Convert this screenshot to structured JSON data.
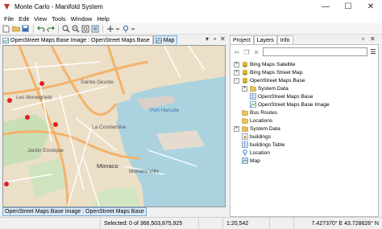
{
  "window": {
    "title": "Monte Carlo - Manifold System"
  },
  "menu": [
    "File",
    "Edit",
    "View",
    "Tools",
    "Window",
    "Help"
  ],
  "map_tabs": [
    {
      "label": "OpenStreet Maps Base Image : OpenStreet Maps Base"
    },
    {
      "label": "Map"
    }
  ],
  "bottom_tab": "OpenStreet Maps Base Image : OpenStreet Maps Base",
  "map": {
    "labels": [
      "Sainte Devote",
      "Les Moneghetti",
      "Port Hercule",
      "La Condamine",
      "Jardin Exotique",
      "Monaco",
      "Monaco Ville"
    ]
  },
  "right_tabs": [
    "Project",
    "Layers",
    "Info"
  ],
  "project_search": {
    "value": ""
  },
  "tree": [
    {
      "label": "Bing Maps Satellite",
      "icon": "database-icon",
      "expanded": false
    },
    {
      "label": "Bing Maps Street Map",
      "icon": "database-icon",
      "expanded": false
    },
    {
      "label": "OpenStreet Maps Base",
      "icon": "database-icon",
      "expanded": true
    },
    {
      "label": "System Data",
      "icon": "folder-icon",
      "expanded": false
    },
    {
      "label": "OpenStreet Maps Base",
      "icon": "table-icon"
    },
    {
      "label": "OpenStreet Maps Base Image",
      "icon": "image-icon"
    },
    {
      "label": "Bus Routes",
      "icon": "folder-icon"
    },
    {
      "label": "Locations",
      "icon": "folder-icon"
    },
    {
      "label": "System Data",
      "icon": "folder-icon",
      "expanded": false
    },
    {
      "label": "buildings",
      "icon": "drawing-icon"
    },
    {
      "label": "buildings Table",
      "icon": "table-icon"
    },
    {
      "label": "Location",
      "icon": "location-icon"
    },
    {
      "label": "Map",
      "icon": "map-icon"
    }
  ],
  "status": {
    "selected": "Selected: 0 of 366,503,875,925",
    "scale": "1:20,542",
    "coords": "7.427370° E 43.728626° N"
  }
}
